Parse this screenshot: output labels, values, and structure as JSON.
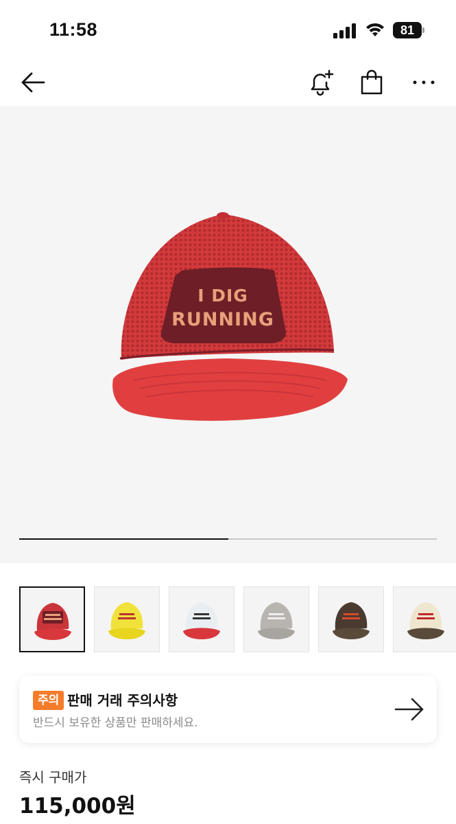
{
  "status_bar": {
    "time": "11:58",
    "battery": "81",
    "icons": [
      "cellular-signal-icon",
      "wifi-icon",
      "battery-icon"
    ]
  },
  "nav": {
    "icons": [
      "back-arrow-icon",
      "bell-plus-icon",
      "shopping-bag-icon",
      "more-dots-icon"
    ]
  },
  "product_image": {
    "patch_text_line1": "I DIG",
    "patch_text_line2": "RUNNING",
    "gallery_progress": 0.5
  },
  "thumbnails": [
    {
      "name": "red-cap",
      "crown": "#c9353a",
      "brim": "#d8383c",
      "patch": "#6e1e26",
      "text": "#e8a07a"
    },
    {
      "name": "yellow-cap",
      "crown": "#f0e23a",
      "brim": "#e8d520",
      "patch": "#f0e23a",
      "text": "#b33"
    },
    {
      "name": "white-red-cap",
      "crown": "#e8eef2",
      "brim": "#d8383c",
      "patch": "#e8eef2",
      "text": "#333"
    },
    {
      "name": "grey-cap",
      "crown": "#b8b4b0",
      "brim": "#a8a4a0",
      "patch": "#b8b4b0",
      "text": "#eee"
    },
    {
      "name": "brown-cap",
      "crown": "#4a3a30",
      "brim": "#5a4a3a",
      "patch": "#4a3a30",
      "text": "#d84a2a"
    },
    {
      "name": "cream-brown-cap",
      "crown": "#efe6cf",
      "brim": "#5a4a3a",
      "patch": "#efe6cf",
      "text": "#c0282a"
    }
  ],
  "notice": {
    "badge": "주의",
    "title": "판매 거래 주의사항",
    "subtitle": "반드시 보유한 상품만 판매하세요."
  },
  "price": {
    "label": "즉시 구매가",
    "value": "115,000원"
  },
  "colors": {
    "accent_orange": "#f47c2a",
    "hero_bg": "#f5f5f5"
  }
}
